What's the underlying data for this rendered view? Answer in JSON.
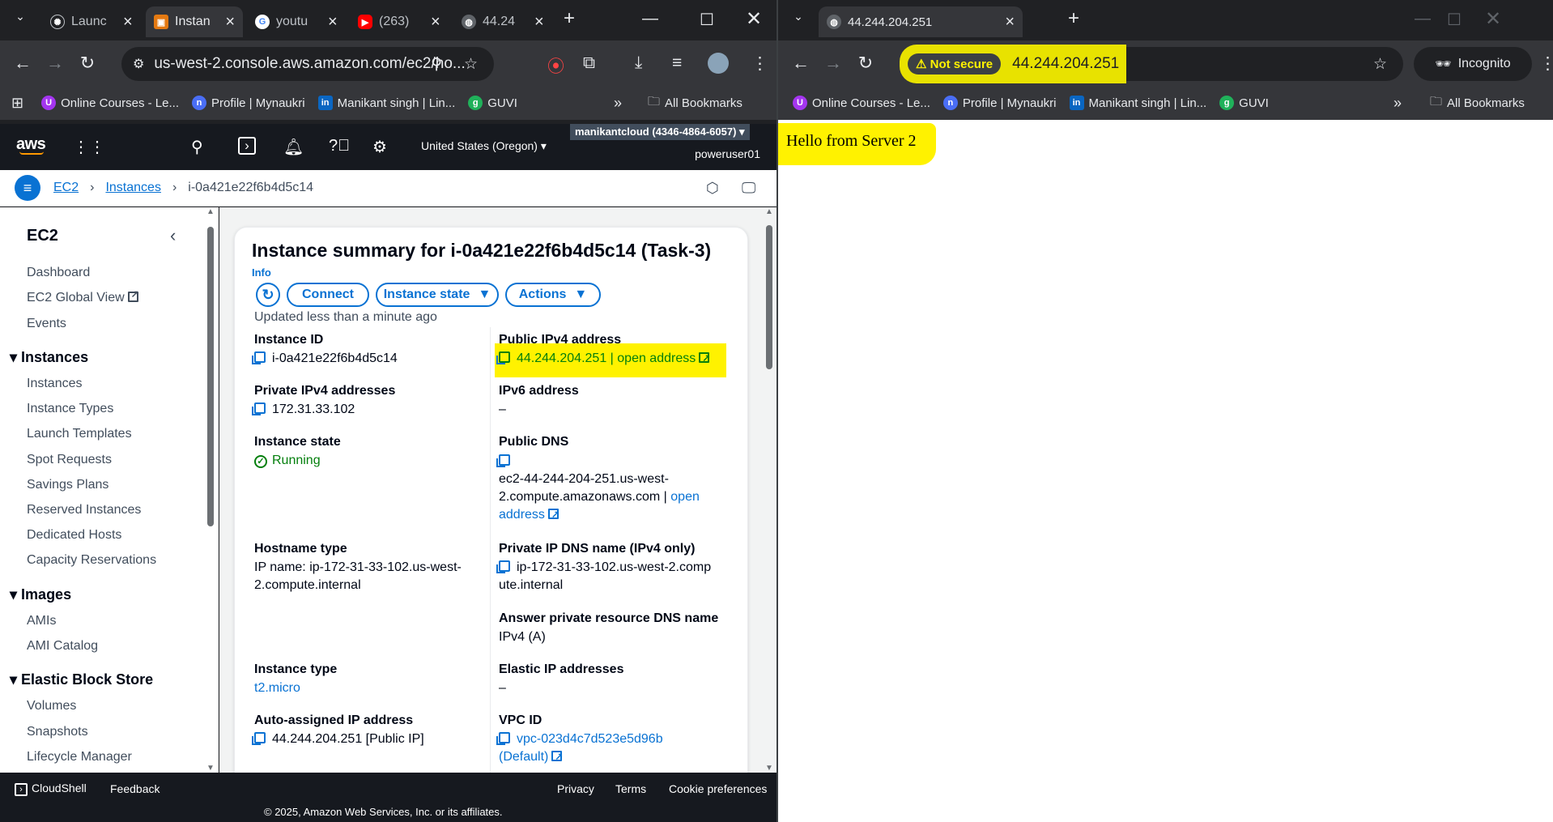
{
  "left_window": {
    "tabs": [
      {
        "label": "Launc",
        "icon": "openai-icon"
      },
      {
        "label": "Instan",
        "icon": "aws-icon",
        "active": true
      },
      {
        "label": "youtu",
        "icon": "google-icon"
      },
      {
        "label": "(263)",
        "icon": "youtube-icon"
      },
      {
        "label": "44.24",
        "icon": "globe-icon"
      }
    ],
    "url": "us-west-2.console.aws.amazon.com/ec2/ho...",
    "bookmarks": [
      {
        "label": "Online Courses - Le...",
        "icon": "udemy-icon",
        "color": "#a435f0",
        "glyph": "U"
      },
      {
        "label": "Profile | Mynaukri",
        "icon": "naukri-icon",
        "color": "#4a6ef5",
        "glyph": "n"
      },
      {
        "label": "Manikant singh | Lin...",
        "icon": "linkedin-icon",
        "color": "#0a66c2",
        "glyph": "in"
      },
      {
        "label": "GUVI",
        "icon": "guvi-icon",
        "color": "#20b15a",
        "glyph": "g"
      }
    ],
    "all_bookmarks": "All Bookmarks"
  },
  "aws": {
    "logo": "aws",
    "region": "United States (Oregon)",
    "account": "manikantcloud (4346-4864-6057)",
    "user": "poweruser01",
    "breadcrumb": [
      "EC2",
      "Instances",
      "i-0a421e22f6b4d5c14"
    ],
    "sidebar": {
      "title": "EC2",
      "top_items": [
        "Dashboard",
        "EC2 Global View",
        "Events"
      ],
      "sections": [
        {
          "title": "Instances",
          "items": [
            "Instances",
            "Instance Types",
            "Launch Templates",
            "Spot Requests",
            "Savings Plans",
            "Reserved Instances",
            "Dedicated Hosts",
            "Capacity Reservations"
          ]
        },
        {
          "title": "Images",
          "items": [
            "AMIs",
            "AMI Catalog"
          ]
        },
        {
          "title": "Elastic Block Store",
          "items": [
            "Volumes",
            "Snapshots",
            "Lifecycle Manager"
          ]
        }
      ]
    },
    "summary": {
      "title": "Instance summary for i-0a421e22f6b4d5c14 (Task-3)",
      "info": "Info",
      "connect": "Connect",
      "instance_state_btn": "Instance state",
      "actions_btn": "Actions",
      "updated": "Updated less than a minute ago",
      "instance_id_label": "Instance ID",
      "instance_id": "i-0a421e22f6b4d5c14",
      "public_ipv4_label": "Public IPv4 address",
      "public_ipv4": "44.244.204.251",
      "open_address": "open address",
      "private_ipv4_label": "Private IPv4 addresses",
      "private_ipv4": "172.31.33.102",
      "ipv6_label": "IPv6 address",
      "ipv6": "–",
      "state_label": "Instance state",
      "state": "Running",
      "public_dns_label": "Public DNS",
      "public_dns_1": "ec2-44-244-204-251.us-west-",
      "public_dns_2": "2.compute.amazonaws.com |",
      "open": "open",
      "address": "address",
      "hostname_type_label": "Hostname type",
      "hostname_1": "IP name: ip-172-31-33-102.us-west-",
      "hostname_2": "2.compute.internal",
      "private_dns_label": "Private IP DNS name (IPv4 only)",
      "private_dns_1": "ip-172-31-33-102.us-west-2.comp",
      "private_dns_2": "ute.internal",
      "answer_dns_label": "Answer private resource DNS name",
      "answer_dns": "IPv4 (A)",
      "instance_type_label": "Instance type",
      "instance_type": "t2.micro",
      "elastic_ip_label": "Elastic IP addresses",
      "elastic_ip": "–",
      "auto_ip_label": "Auto-assigned IP address",
      "auto_ip": "44.244.204.251 [Public IP]",
      "vpc_label": "VPC ID",
      "vpc_id": "vpc-023d4c7d523e5d96b",
      "vpc_default": "(Default)"
    },
    "footer": {
      "cloudshell": "CloudShell",
      "feedback": "Feedback",
      "privacy": "Privacy",
      "terms": "Terms",
      "cookies": "Cookie preferences",
      "copyright": "© 2025, Amazon Web Services, Inc. or its affiliates."
    }
  },
  "right_window": {
    "tab": "44.244.204.251",
    "not_secure": "Not secure",
    "url": "44.244.204.251",
    "incognito": "Incognito",
    "bookmarks": [
      {
        "label": "Online Courses - Le...",
        "color": "#a435f0",
        "glyph": "U"
      },
      {
        "label": "Profile | Mynaukri",
        "color": "#4a6ef5",
        "glyph": "n"
      },
      {
        "label": "Manikant singh | Lin...",
        "color": "#0a66c2",
        "glyph": "in"
      },
      {
        "label": "GUVI",
        "color": "#20b15a",
        "glyph": "g"
      }
    ],
    "all_bookmarks": "All Bookmarks",
    "page_text": "Hello from Server 2"
  },
  "colors": {
    "highlight": "#fff200",
    "aws_nav": "#16191f",
    "link": "#0972d3",
    "success": "#037f0c"
  }
}
